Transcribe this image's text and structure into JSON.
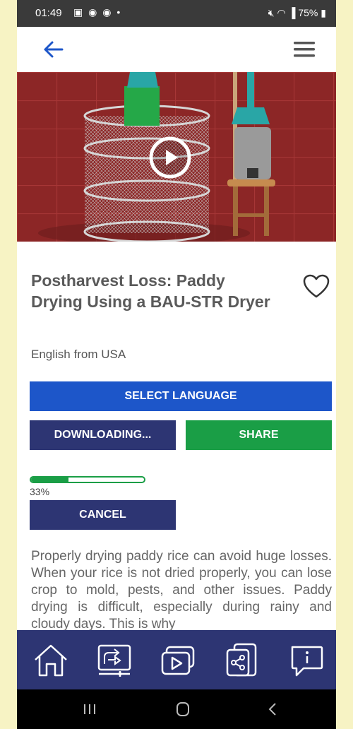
{
  "status_bar": {
    "time": "01:49",
    "left_icons": "▣ ◉ ◉ •",
    "battery": "75%"
  },
  "video": {
    "colors": {
      "wall": "#8c2626",
      "bin": "#25a848",
      "cap": "#29a6a6"
    }
  },
  "details": {
    "title": "Postharvest Loss: Paddy Drying Using a BAU-STR Dryer",
    "language": "English from USA",
    "favorited": false
  },
  "actions": {
    "select_language": "SELECT LANGUAGE",
    "downloading": "DOWNLOADING...",
    "share": "SHARE",
    "cancel": "CANCEL"
  },
  "download": {
    "progress": 0.33,
    "progress_label": "33%"
  },
  "description": "Properly drying paddy rice can avoid huge losses. When your rice is not dried properly, you can lose crop to mold, pests, and other issues. Paddy drying is difficult, especially during rainy and cloudy days. This is why",
  "bottom_nav": [
    "home-icon",
    "presentation-icon",
    "videos-icon",
    "share-device-icon",
    "info-icon"
  ],
  "colors": {
    "primary_blue": "#1d56c9",
    "navy": "#2d3573",
    "green": "#1a9e46",
    "page_bg": "#f7f3c4"
  }
}
